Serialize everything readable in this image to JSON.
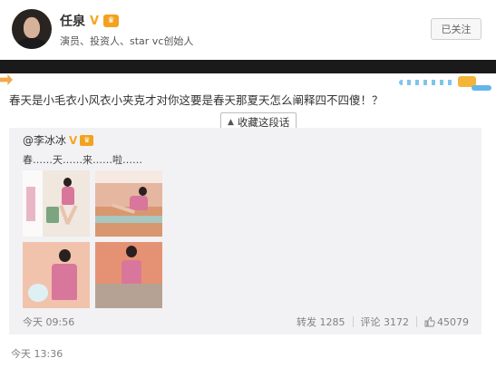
{
  "profile": {
    "name": "任泉",
    "verified_badge": "V",
    "bio": "演员、投资人、star vc创始人",
    "follow_label": "已关注"
  },
  "post": {
    "text": "春天是小毛衣小风衣小夹克才对你这要是春天那夏天怎么阐释四不四傻！？",
    "collect_label": "收藏这段话",
    "time": "今天 13:36"
  },
  "repost": {
    "author": "@李冰冰",
    "verified_badge": "V",
    "text": "春……天……来……啦……",
    "time": "今天 09:56",
    "stats": {
      "forward_label": "转发 1285",
      "comment_label": "评论 3172",
      "likes": "45079"
    }
  },
  "colors": {
    "accent_orange": "#f6a623",
    "link_blue": "#eb7350"
  },
  "icons": {
    "vip": "crown-icon",
    "like": "thumb-up-icon",
    "collect": "arrow-up-icon"
  }
}
